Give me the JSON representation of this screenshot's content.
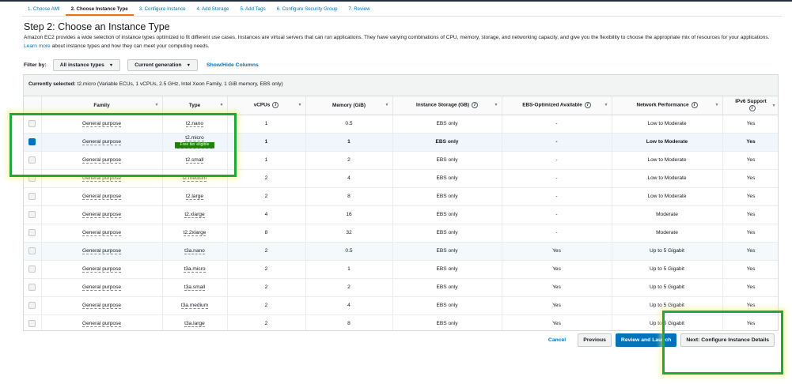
{
  "steps": [
    {
      "label": "1. Choose AMI",
      "active": false
    },
    {
      "label": "2. Choose Instance Type",
      "active": true
    },
    {
      "label": "3. Configure Instance",
      "active": false
    },
    {
      "label": "4. Add Storage",
      "active": false
    },
    {
      "label": "5. Add Tags",
      "active": false
    },
    {
      "label": "6. Configure Security Group",
      "active": false
    },
    {
      "label": "7. Review",
      "active": false
    }
  ],
  "page": {
    "title": "Step 2: Choose an Instance Type",
    "description": "Amazon EC2 provides a wide selection of instance types optimized to fit different use cases. Instances are virtual servers that can run applications. They have varying combinations of CPU, memory, storage, and networking capacity, and give you the flexibility to choose the appropriate mix of resources for your applications.",
    "learn_more": "Learn more",
    "description_tail": "about instance types and how they can meet your computing needs."
  },
  "filter": {
    "label": "Filter by:",
    "type_filter": "All instance types",
    "generation_filter": "Current generation",
    "show_hide": "Show/Hide Columns"
  },
  "selected": {
    "label": "Currently selected:",
    "value": "t2.micro (Variable ECUs, 1 vCPUs, 2.5 GHz, Intel Xeon Family, 1 GiB memory, EBS only)"
  },
  "columns": {
    "family": "Family",
    "type": "Type",
    "vcpus": "vCPUs",
    "memory": "Memory (GiB)",
    "storage": "Instance Storage (GB)",
    "ebs": "EBS-Optimized Available",
    "network": "Network Performance",
    "ipv6": "IPv6 Support"
  },
  "free_tier_badge": "Free tier eligible",
  "rows": [
    {
      "family": "General purpose",
      "type": "t2.nano",
      "vcpus": "1",
      "memory": "0.5",
      "storage": "EBS only",
      "ebs": "-",
      "network": "Low to Moderate",
      "ipv6": "Yes"
    },
    {
      "family": "General purpose",
      "type": "t2.micro",
      "vcpus": "1",
      "memory": "1",
      "storage": "EBS only",
      "ebs": "-",
      "network": "Low to Moderate",
      "ipv6": "Yes"
    },
    {
      "family": "General purpose",
      "type": "t2.small",
      "vcpus": "1",
      "memory": "2",
      "storage": "EBS only",
      "ebs": "-",
      "network": "Low to Moderate",
      "ipv6": "Yes"
    },
    {
      "family": "General purpose",
      "type": "t2.medium",
      "vcpus": "2",
      "memory": "4",
      "storage": "EBS only",
      "ebs": "-",
      "network": "Low to Moderate",
      "ipv6": "Yes"
    },
    {
      "family": "General purpose",
      "type": "t2.large",
      "vcpus": "2",
      "memory": "8",
      "storage": "EBS only",
      "ebs": "-",
      "network": "Low to Moderate",
      "ipv6": "Yes"
    },
    {
      "family": "General purpose",
      "type": "t2.xlarge",
      "vcpus": "4",
      "memory": "16",
      "storage": "EBS only",
      "ebs": "-",
      "network": "Moderate",
      "ipv6": "Yes"
    },
    {
      "family": "General purpose",
      "type": "t2.2xlarge",
      "vcpus": "8",
      "memory": "32",
      "storage": "EBS only",
      "ebs": "-",
      "network": "Moderate",
      "ipv6": "Yes"
    },
    {
      "family": "General purpose",
      "type": "t3a.nano",
      "vcpus": "2",
      "memory": "0.5",
      "storage": "EBS only",
      "ebs": "Yes",
      "network": "Up to 5 Gigabit",
      "ipv6": "Yes"
    },
    {
      "family": "General purpose",
      "type": "t3a.micro",
      "vcpus": "2",
      "memory": "1",
      "storage": "EBS only",
      "ebs": "Yes",
      "network": "Up to 5 Gigabit",
      "ipv6": "Yes"
    },
    {
      "family": "General purpose",
      "type": "t3a.small",
      "vcpus": "2",
      "memory": "2",
      "storage": "EBS only",
      "ebs": "Yes",
      "network": "Up to 5 Gigabit",
      "ipv6": "Yes"
    },
    {
      "family": "General purpose",
      "type": "t3a.medium",
      "vcpus": "2",
      "memory": "4",
      "storage": "EBS only",
      "ebs": "Yes",
      "network": "Up to 5 Gigabit",
      "ipv6": "Yes"
    },
    {
      "family": "General purpose",
      "type": "t3a.large",
      "vcpus": "2",
      "memory": "8",
      "storage": "EBS only",
      "ebs": "Yes",
      "network": "Up to 5 Gigabit",
      "ipv6": "Yes"
    }
  ],
  "selected_row_index": 1,
  "footer": {
    "cancel": "Cancel",
    "previous": "Previous",
    "review": "Review and Launch",
    "next": "Next: Configure Instance Details"
  },
  "colors": {
    "accent": "#0073bb",
    "active_tab": "#ec7211",
    "annotation": "#22a83a",
    "badge": "#1d8102"
  }
}
